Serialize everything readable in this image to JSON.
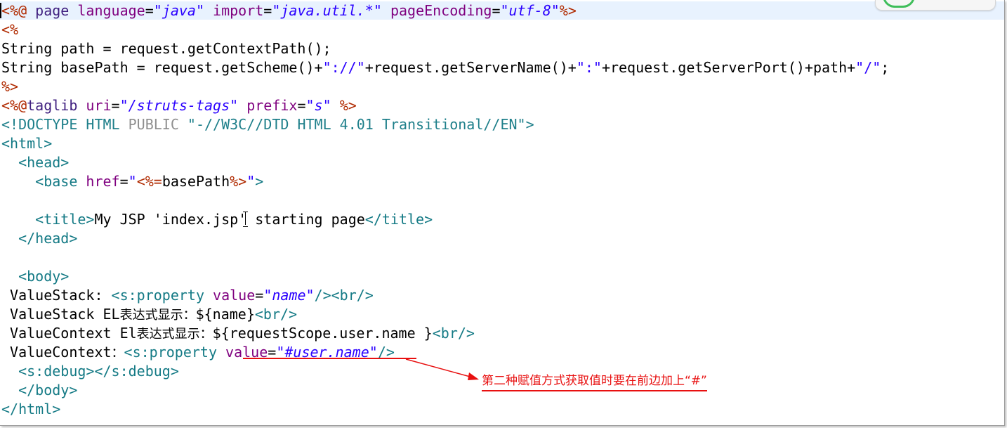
{
  "editor": {
    "lines": [
      [
        {
          "c": "t-delim",
          "t": "<%@"
        },
        {
          "c": "t-kw",
          "t": " page "
        },
        {
          "c": "t-attr",
          "t": "language"
        },
        {
          "c": "t-plain",
          "t": "="
        },
        {
          "c": "t-val",
          "t": "\"java\""
        },
        {
          "c": "t-plain",
          "t": " "
        },
        {
          "c": "t-attr",
          "t": "import"
        },
        {
          "c": "t-plain",
          "t": "="
        },
        {
          "c": "t-val",
          "t": "\"java.util.*\""
        },
        {
          "c": "t-plain",
          "t": " "
        },
        {
          "c": "t-attr",
          "t": "pageEncoding"
        },
        {
          "c": "t-plain",
          "t": "="
        },
        {
          "c": "t-val",
          "t": "\"utf-8\""
        },
        {
          "c": "t-delim",
          "t": "%>"
        }
      ],
      [
        {
          "c": "t-delim",
          "t": "<%"
        }
      ],
      [
        {
          "c": "t-plain",
          "t": "String path = request.getContextPath();"
        }
      ],
      [
        {
          "c": "t-plain",
          "t": "String basePath = request.getScheme()+"
        },
        {
          "c": "t-str",
          "t": "\"://\""
        },
        {
          "c": "t-plain",
          "t": "+request.getServerName()+"
        },
        {
          "c": "t-str",
          "t": "\":\""
        },
        {
          "c": "t-plain",
          "t": "+request.getServerPort()+path+"
        },
        {
          "c": "t-str",
          "t": "\"/\""
        },
        {
          "c": "t-plain",
          "t": ";"
        }
      ],
      [
        {
          "c": "t-delim",
          "t": "%>"
        }
      ],
      [
        {
          "c": "t-delim",
          "t": "<%@"
        },
        {
          "c": "t-kw",
          "t": "taglib "
        },
        {
          "c": "t-attr",
          "t": "uri"
        },
        {
          "c": "t-plain",
          "t": "="
        },
        {
          "c": "t-val",
          "t": "\"/struts-tags\""
        },
        {
          "c": "t-plain",
          "t": " "
        },
        {
          "c": "t-attr",
          "t": "prefix"
        },
        {
          "c": "t-plain",
          "t": "="
        },
        {
          "c": "t-val",
          "t": "\"s\""
        },
        {
          "c": "t-plain",
          "t": " "
        },
        {
          "c": "t-delim",
          "t": "%>"
        }
      ],
      [
        {
          "c": "t-doctype",
          "t": "<!DOCTYPE HTML "
        },
        {
          "c": "t-doctype-grey",
          "t": "PUBLIC "
        },
        {
          "c": "t-doctype",
          "t": "\"-//W3C//DTD HTML 4.01 Transitional//EN\">"
        }
      ],
      [
        {
          "c": "t-tag",
          "t": "<html>"
        }
      ],
      [
        {
          "c": "t-plain",
          "t": "  "
        },
        {
          "c": "t-tag",
          "t": "<head>"
        }
      ],
      [
        {
          "c": "t-plain",
          "t": "    "
        },
        {
          "c": "t-tag",
          "t": "<base "
        },
        {
          "c": "t-attr",
          "t": "href"
        },
        {
          "c": "t-plain",
          "t": "="
        },
        {
          "c": "t-str",
          "t": "\""
        },
        {
          "c": "t-delim",
          "t": "<%="
        },
        {
          "c": "t-plain",
          "t": "basePath"
        },
        {
          "c": "t-delim",
          "t": "%>"
        },
        {
          "c": "t-str",
          "t": "\""
        },
        {
          "c": "t-tag",
          "t": ">"
        }
      ],
      [],
      [
        {
          "c": "t-plain",
          "t": "    "
        },
        {
          "c": "t-tag",
          "t": "<title>"
        },
        {
          "c": "t-plain",
          "t": "My JSP 'index.jsp' starting page"
        },
        {
          "c": "t-tag",
          "t": "</title>"
        }
      ],
      [
        {
          "c": "t-plain",
          "t": "  "
        },
        {
          "c": "t-tag",
          "t": "</head>"
        }
      ],
      [],
      [
        {
          "c": "t-plain",
          "t": "  "
        },
        {
          "c": "t-tag",
          "t": "<body>"
        }
      ],
      [
        {
          "c": "t-plain",
          "t": " ValueStack: "
        },
        {
          "c": "t-tag",
          "t": "<s:property "
        },
        {
          "c": "t-attr",
          "t": "value"
        },
        {
          "c": "t-plain",
          "t": "="
        },
        {
          "c": "t-val",
          "t": "\"name\""
        },
        {
          "c": "t-tag",
          "t": "/><br/>"
        }
      ],
      [
        {
          "c": "t-plain",
          "t": " ValueStack EL"
        },
        {
          "c": "t-plain t-cjk",
          "t": "表达式显示："
        },
        {
          "c": "t-plain",
          "t": "${name}"
        },
        {
          "c": "t-tag",
          "t": "<br/>"
        }
      ],
      [
        {
          "c": "t-plain",
          "t": " ValueContext El"
        },
        {
          "c": "t-plain t-cjk",
          "t": "表达式显示："
        },
        {
          "c": "t-plain",
          "t": "${requestScope.user.name }"
        },
        {
          "c": "t-tag",
          "t": "<br/>"
        }
      ],
      [
        {
          "c": "t-plain",
          "t": " ValueContext"
        },
        {
          "c": "t-plain t-cjk",
          "t": "："
        },
        {
          "c": "t-tag",
          "t": "<s:property "
        },
        {
          "c": "t-attr",
          "t": "value"
        },
        {
          "c": "t-plain",
          "t": "="
        },
        {
          "c": "t-val",
          "t": "\"#user.name\""
        },
        {
          "c": "t-tag",
          "t": "/>"
        }
      ],
      [
        {
          "c": "t-plain",
          "t": "  "
        },
        {
          "c": "t-tag",
          "t": "<s:debug></s:debug>"
        }
      ],
      [
        {
          "c": "t-plain",
          "t": "  "
        },
        {
          "c": "t-tag",
          "t": "</body>"
        }
      ],
      [
        {
          "c": "t-tag",
          "t": "</html>"
        }
      ]
    ]
  },
  "annotation": {
    "text": "第二种赋值方式获取值时要在前边加上“#”",
    "color": "#e81010"
  },
  "colors": {
    "current_line": "#e8f2fe",
    "tag": "#147a85",
    "attribute": "#7f007f",
    "value": "#2a00ff",
    "jsp_delimiter": "#b02a00"
  }
}
